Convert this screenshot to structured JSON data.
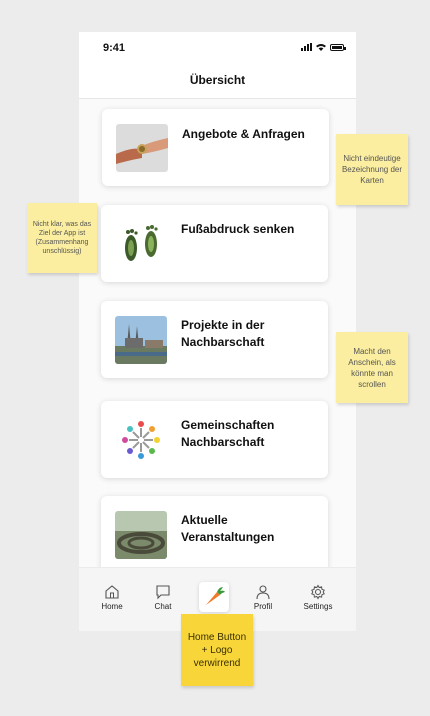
{
  "status_bar": {
    "time": "9:41"
  },
  "header": {
    "title": "Übersicht"
  },
  "cards": [
    {
      "label": "Angebote & Anfragen",
      "image": "hands-giving-image"
    },
    {
      "label": "Fußabdruck senken",
      "image": "footprints-image"
    },
    {
      "label": "Projekte in der Nachbarschaft",
      "image": "cathedral-city-image"
    },
    {
      "label": "Gemeinschaften Nachbarschaft",
      "image": "people-circle-image"
    },
    {
      "label": "Aktuelle Veranstaltungen",
      "image": "crowd-event-image"
    }
  ],
  "tabbar": {
    "items": [
      {
        "label": "Home",
        "icon": "home-icon"
      },
      {
        "label": "Chat",
        "icon": "chat-icon"
      },
      {
        "label": "",
        "icon": "carrot-logo-icon"
      },
      {
        "label": "Profil",
        "icon": "profile-icon"
      },
      {
        "label": "Settings",
        "icon": "settings-icon"
      }
    ]
  },
  "notes": {
    "left": "Nicht klar, was das Ziel der App ist (Zusammenhang unschlüssig)",
    "right_top": "Nicht eindeutige Bezeichnung der Karten",
    "right_mid": "Macht den Anschein, als könnte man scrollen",
    "bottom": "Home Button + Logo verwirrend"
  },
  "colors": {
    "sticky": "#fbeea0",
    "sticky_strong": "#f8d63a",
    "carrot": "#f07a2a"
  }
}
